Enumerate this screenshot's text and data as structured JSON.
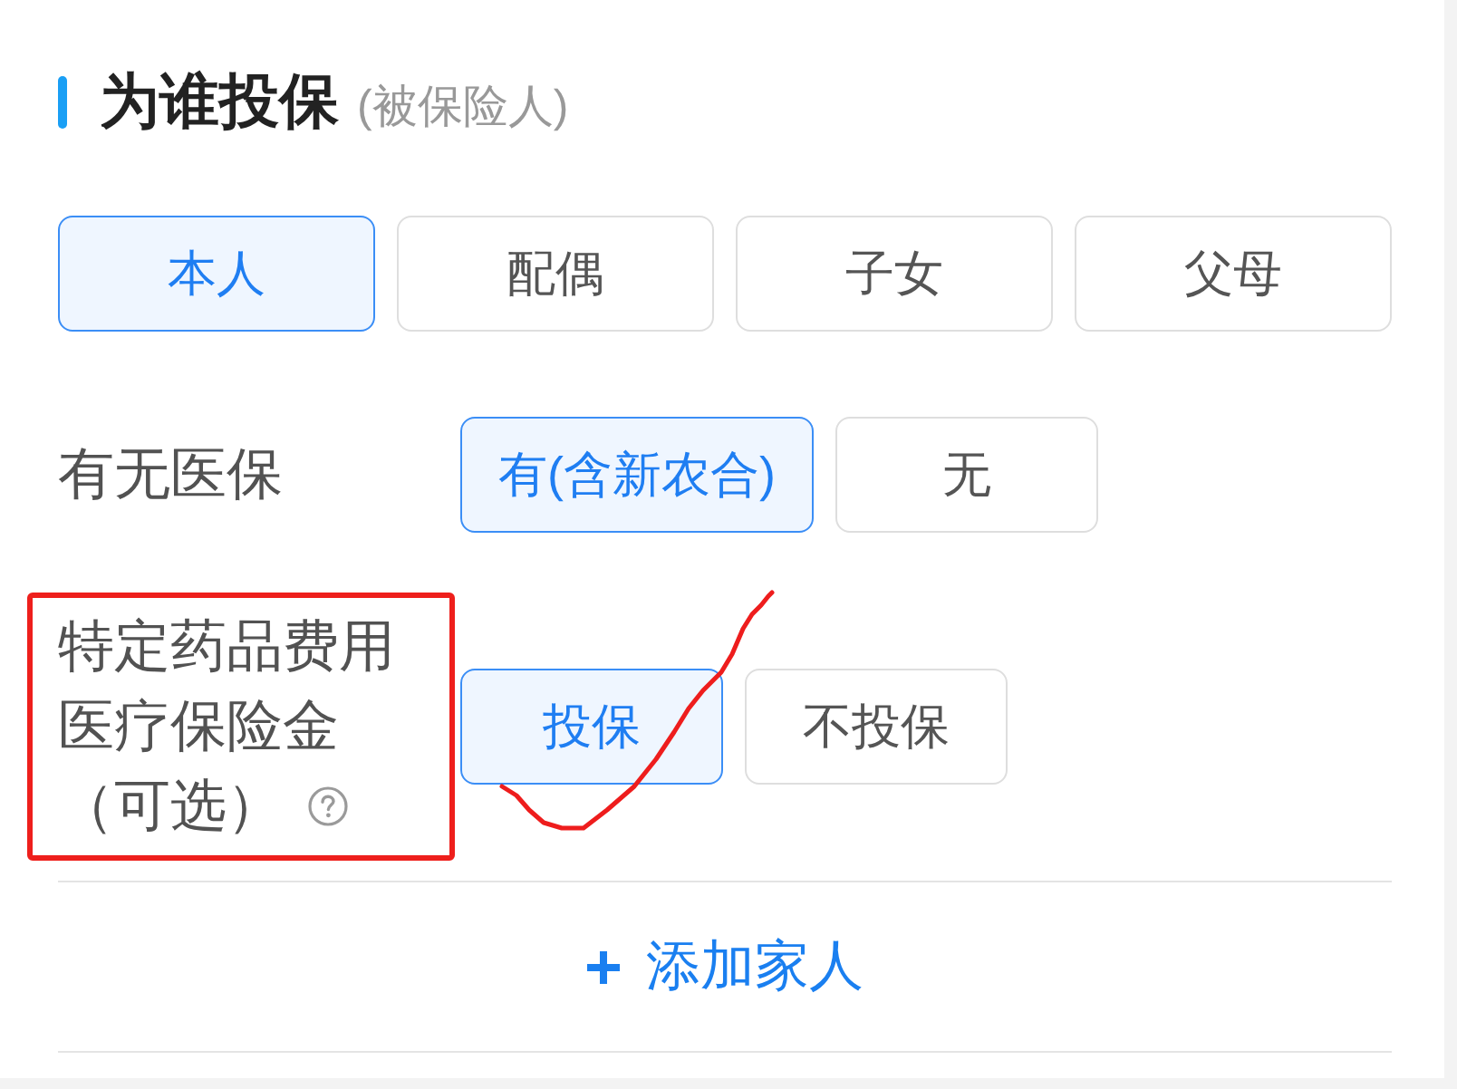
{
  "section": {
    "title": "为谁投保",
    "subtitle": "(被保险人)"
  },
  "insured_options": [
    {
      "label": "本人",
      "selected": true
    },
    {
      "label": "配偶",
      "selected": false
    },
    {
      "label": "子女",
      "selected": false
    },
    {
      "label": "父母",
      "selected": false
    }
  ],
  "questions": [
    {
      "label": "有无医保",
      "help": false,
      "circled": false,
      "options": [
        {
          "label": "有(含新农合)",
          "selected": true,
          "ticked": false
        },
        {
          "label": "无",
          "selected": false,
          "ticked": false
        }
      ]
    },
    {
      "label": "特定药品费用医疗保险金",
      "note": "（可选）",
      "help": true,
      "circled": true,
      "options": [
        {
          "label": "投保",
          "selected": true,
          "ticked": true
        },
        {
          "label": "不投保",
          "selected": false,
          "ticked": false
        }
      ]
    }
  ],
  "add_button": {
    "label": "添加家人"
  }
}
